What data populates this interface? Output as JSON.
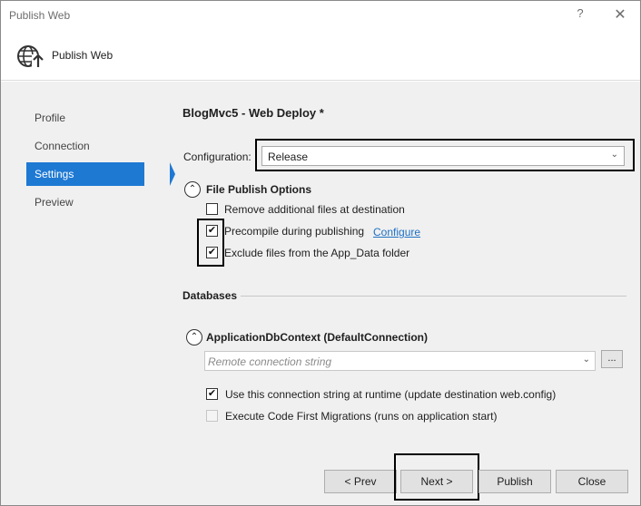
{
  "window": {
    "title": "Publish Web",
    "help_glyph": "?",
    "close_glyph": "✕"
  },
  "header": {
    "title": "Publish Web",
    "icon": "globe-publish-icon"
  },
  "nav": {
    "items": [
      {
        "label": "Profile",
        "active": false
      },
      {
        "label": "Connection",
        "active": false
      },
      {
        "label": "Settings",
        "active": true
      },
      {
        "label": "Preview",
        "active": false
      }
    ]
  },
  "settings": {
    "title": "BlogMvc5 - Web Deploy *",
    "configuration_label": "Configuration:",
    "configuration_value": "Release",
    "file_publish": {
      "heading": "File Publish Options",
      "options": [
        {
          "label": "Remove additional files at destination",
          "checked": false
        },
        {
          "label": "Precompile during publishing",
          "checked": true
        },
        {
          "label": "Exclude files from the App_Data folder",
          "checked": true
        }
      ],
      "configure_link": "Configure"
    },
    "databases": {
      "heading": "Databases",
      "context_heading": "ApplicationDbContext (DefaultConnection)",
      "connection_placeholder": "Remote connection string",
      "dots_label": "...",
      "options": [
        {
          "label": "Use this connection string at runtime (update destination web.config)",
          "checked": true,
          "enabled": true
        },
        {
          "label": "Execute Code First Migrations (runs on application start)",
          "checked": false,
          "enabled": false
        }
      ]
    }
  },
  "footer": {
    "prev_label": "< Prev",
    "next_label": "Next >",
    "publish_label": "Publish",
    "close_label": "Close"
  },
  "colors": {
    "accent": "#1e79d3",
    "link": "#1c70c4",
    "body_bg": "#f0f0f0"
  }
}
